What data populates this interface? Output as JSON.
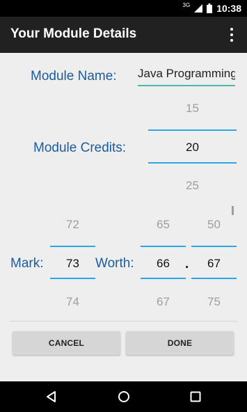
{
  "status_bar": {
    "network": "3G",
    "time": "10:38"
  },
  "action_bar": {
    "title": "Your Module Details",
    "overflow_icon": "more-vert-icon"
  },
  "module_name": {
    "label": "Module Name:",
    "value": "Java Programming"
  },
  "module_credits": {
    "label": "Module Credits:",
    "prev": "15",
    "current": "20",
    "next": "25"
  },
  "mark": {
    "label": "Mark:",
    "prev": "72",
    "current": "73",
    "next": "74"
  },
  "worth": {
    "label": "Worth:",
    "whole": {
      "prev": "65",
      "current": "66",
      "next": "67"
    },
    "decimal_separator": ".",
    "fraction": {
      "prev": "50",
      "current": "67",
      "next": "75"
    }
  },
  "buttons": {
    "cancel": "CANCEL",
    "done": "DONE"
  },
  "nav_bar": {
    "back": "back-icon",
    "home": "home-icon",
    "recents": "recents-icon"
  },
  "colors": {
    "label": "#1a5c9e",
    "picker_divider": "#2aa6e6",
    "name_underline": "#4db6ac"
  }
}
